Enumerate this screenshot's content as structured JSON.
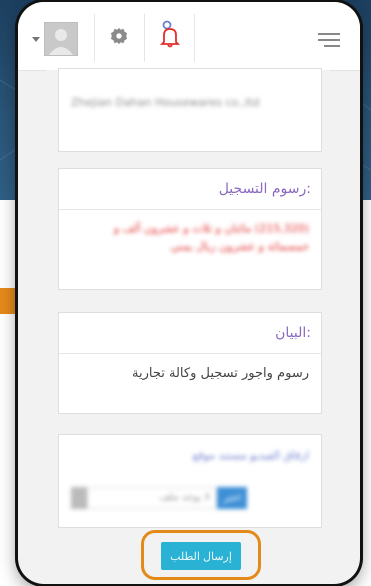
{
  "cards": {
    "fees": {
      "heading": "رسوم التسجيل:",
      "amount": "(215,320) مائتان و ثلاث و عشرون ألف و خمسمائة و عشرون ريال يمني"
    },
    "statement": {
      "heading": "البيان:",
      "text": "رسوم واجور تسجيل وكالة تجارية"
    },
    "top_partial": {
      "text": "Zhejian Dahan Housewares co.,ltd"
    },
    "attachments": {
      "title": "ارفاق الفيديو مستند موقع",
      "choose_label": "اختر",
      "file_placeholder": "لا يوجد ملف"
    }
  },
  "submit": {
    "label": "إرسال الطلب"
  },
  "colors": {
    "accent_orange": "#e48a1a",
    "button_blue": "#29b2d4",
    "heading_purple": "#8a6ac0",
    "alert_red": "#e2302f"
  },
  "icons": [
    "user-avatar-icon",
    "gear-icon",
    "bell-icon",
    "hamburger-menu-icon"
  ]
}
